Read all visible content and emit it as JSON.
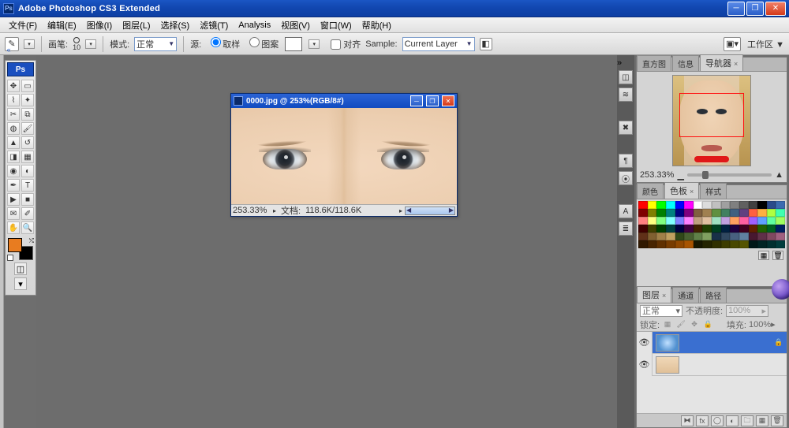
{
  "app": {
    "icon": "Ps",
    "title": "Adobe Photoshop CS3 Extended"
  },
  "menu": {
    "items": [
      "文件(F)",
      "编辑(E)",
      "图像(I)",
      "图层(L)",
      "选择(S)",
      "滤镜(T)",
      "Analysis",
      "视图(V)",
      "窗口(W)",
      "帮助(H)"
    ]
  },
  "options": {
    "brush_label": "画笔:",
    "brush_size": "10",
    "mode_label": "模式:",
    "mode_value": "正常",
    "source_label": "源:",
    "r1": "取样",
    "r2": "图案",
    "align": "对齐",
    "sample_label": "Sample:",
    "sample_value": "Current Layer",
    "workspace": "工作区 ▼"
  },
  "document": {
    "title": "0000.jpg @ 253%(RGB/8#)",
    "zoom": "253.33%",
    "doc_label": "文档:",
    "filesize": "118.6K/118.6K"
  },
  "panels": {
    "nav": {
      "tabs": [
        "直方图",
        "信息",
        "导航器"
      ],
      "active": 2,
      "zoom": "253.33%"
    },
    "swatch": {
      "tabs": [
        "颜色",
        "色板",
        "样式"
      ],
      "active": 1
    },
    "layers": {
      "tabs": [
        "图层",
        "通道",
        "路径"
      ],
      "active": 0,
      "blend": "正常",
      "opacity_label": "不透明度:",
      "opacity": "100%",
      "lock_label": "锁定:",
      "fill_label": "填充:",
      "fill": "100%",
      "rows": [
        {
          "visible": true,
          "name": "",
          "active": true
        },
        {
          "visible": true,
          "name": "",
          "active": false
        }
      ]
    }
  },
  "swatch_colors": [
    "#ff0000",
    "#ffff00",
    "#00ff00",
    "#00ffff",
    "#0000ff",
    "#ff00ff",
    "#ffffff",
    "#dcdcdc",
    "#c0c0c0",
    "#a0a0a0",
    "#808080",
    "#606060",
    "#404040",
    "#000000",
    "#2a4a8a",
    "#3a6ab0",
    "#800000",
    "#808000",
    "#008000",
    "#008080",
    "#000080",
    "#800080",
    "#806040",
    "#a08050",
    "#609040",
    "#408060",
    "#406080",
    "#604080",
    "#ff6040",
    "#ffb040",
    "#b0ff40",
    "#40ffb0",
    "#ff8080",
    "#ffff80",
    "#80ff80",
    "#80ffff",
    "#8080ff",
    "#ff80ff",
    "#c0a080",
    "#e0c0a0",
    "#a0e0c0",
    "#c0a0e0",
    "#ffa060",
    "#ff60a0",
    "#a060ff",
    "#60a0ff",
    "#60ffa0",
    "#a0ff60",
    "#400000",
    "#404000",
    "#004000",
    "#004040",
    "#000040",
    "#400040",
    "#402000",
    "#204000",
    "#004020",
    "#002040",
    "#200040",
    "#400020",
    "#602000",
    "#206000",
    "#006020",
    "#002060",
    "#603018",
    "#806030",
    "#a08048",
    "#c0a060",
    "#304818",
    "#486030",
    "#608048",
    "#80a060",
    "#183048",
    "#304860",
    "#486080",
    "#6080a0",
    "#481830",
    "#603048",
    "#804860",
    "#a06080",
    "#301800",
    "#482400",
    "#603000",
    "#783c00",
    "#904800",
    "#a85400",
    "#181800",
    "#242400",
    "#303000",
    "#3c3c00",
    "#484800",
    "#545400",
    "#001818",
    "#002424",
    "#003030",
    "#003c3c"
  ]
}
